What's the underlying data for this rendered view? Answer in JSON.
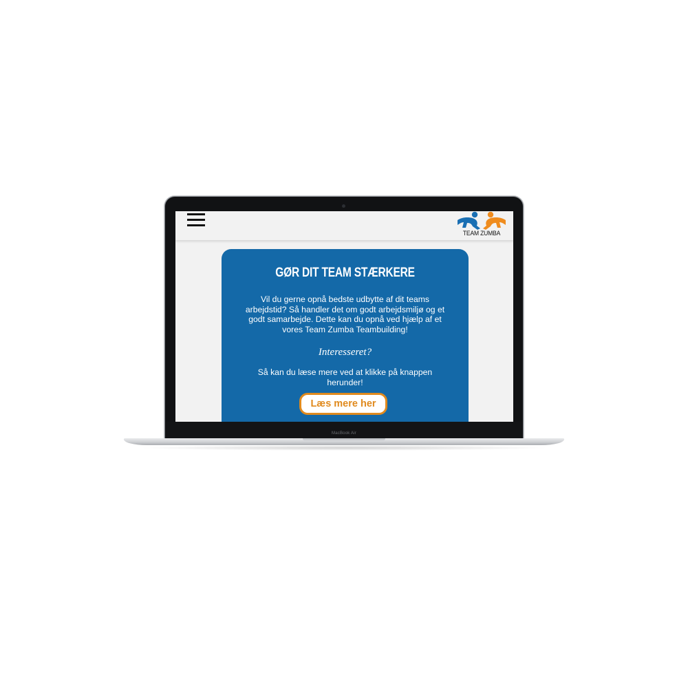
{
  "device": {
    "model_label": "MacBook Air"
  },
  "header": {
    "menu_icon": "hamburger-menu-icon",
    "logo": {
      "icon": "two-dancers-logo-icon",
      "text": "TEAM ZUMBA",
      "colors": {
        "left_figure": "#1a6fb3",
        "right_figure": "#ef8c1e"
      }
    }
  },
  "hero": {
    "title": "GØR DIT TEAM STÆRKERE",
    "text": "Vil du gerne opnå bedste udbytte af dit teams arbejdstid? Så handler det om godt arbejdsmiljø og et godt samarbejde. Dette kan du opnå ved hjælp af et vores Team Zumba Teambuilding!",
    "question": "Interesseret?",
    "cta_text": "Så kan du læse mere ved at klikke på knappen herunder!",
    "button_label": "Læs mere her",
    "colors": {
      "card_background": "#1469a8",
      "button_accent": "#e08a1e"
    }
  }
}
